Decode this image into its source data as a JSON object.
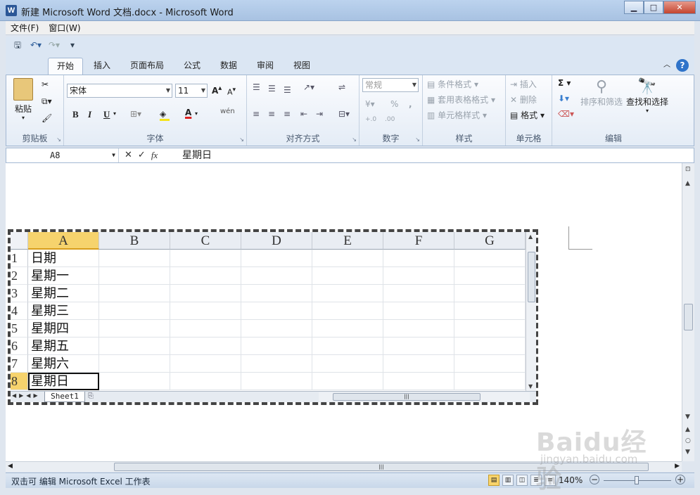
{
  "window": {
    "title": "新建 Microsoft Word 文档.docx - Microsoft Word",
    "app_icon": "W",
    "minimize": "▁",
    "maximize": "□",
    "close": "✕"
  },
  "menubar": {
    "items": [
      "文件(F)",
      "窗口(W)"
    ]
  },
  "qat": {
    "icons": [
      "save-icon",
      "undo-icon",
      "redo-icon",
      "customize-icon"
    ]
  },
  "ribbon_tabs": [
    "开始",
    "插入",
    "页面布局",
    "公式",
    "数据",
    "审阅",
    "视图"
  ],
  "active_tab": "开始",
  "ribbon": {
    "clipboard": {
      "paste": "粘贴",
      "label": "剪贴板"
    },
    "font": {
      "name": "宋体",
      "size": "11",
      "bold": "B",
      "italic": "I",
      "underline": "U",
      "font_color": "A",
      "phonetic": "wén",
      "label": "字体"
    },
    "alignment": {
      "label": "对齐方式"
    },
    "number": {
      "format": "常规",
      "percent": "%",
      "comma": ",",
      "inc_dec": "+.0",
      "dec_dec": ".00",
      "label": "数字"
    },
    "styles": {
      "conditional": "条件格式",
      "table": "套用表格格式",
      "cell": "单元格样式",
      "label": "样式"
    },
    "cells": {
      "insert": "插入",
      "delete": "删除",
      "format": "格式",
      "label": "单元格"
    },
    "editing": {
      "sum": "Σ",
      "sort_filter": "排序和筛选",
      "find_select": "查找和选择",
      "label": "编辑"
    }
  },
  "formula_bar": {
    "name_box": "A8",
    "cancel": "✕",
    "enter": "✓",
    "fx": "fx",
    "value": "星期日"
  },
  "sheet": {
    "columns": [
      "A",
      "B",
      "C",
      "D",
      "E",
      "F",
      "G"
    ],
    "selected_column": "A",
    "rows": [
      {
        "n": "1",
        "a": "日期"
      },
      {
        "n": "2",
        "a": "星期一"
      },
      {
        "n": "3",
        "a": "星期二"
      },
      {
        "n": "4",
        "a": "星期三"
      },
      {
        "n": "5",
        "a": "星期四"
      },
      {
        "n": "6",
        "a": "星期五"
      },
      {
        "n": "7",
        "a": "星期六"
      },
      {
        "n": "8",
        "a": "星期日"
      }
    ],
    "active_cell": "A8",
    "tab": "Sheet1"
  },
  "status": {
    "text": "双击可 编辑 Microsoft Excel 工作表",
    "zoom": "140%",
    "zoom_fraction": 0.4
  },
  "watermark": {
    "logo": "Baidu经验",
    "url": "jingyan.baidu.com"
  }
}
